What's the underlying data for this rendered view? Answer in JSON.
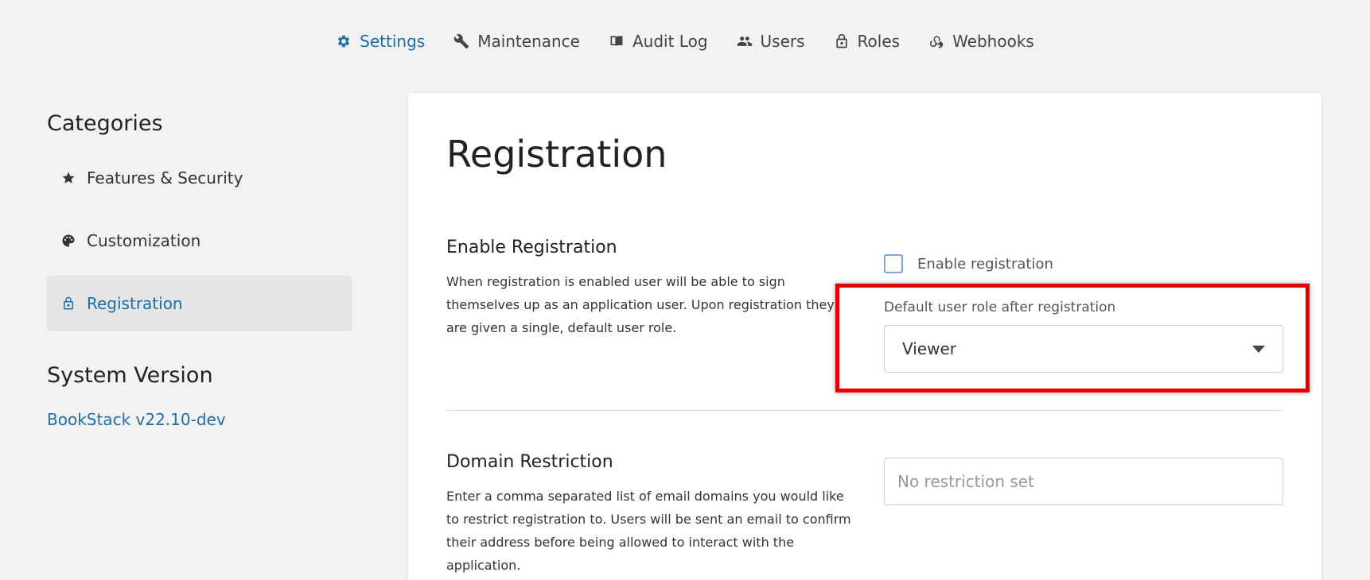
{
  "topnav": {
    "items": [
      {
        "label": "Settings",
        "icon": "gear-icon",
        "active": true
      },
      {
        "label": "Maintenance",
        "icon": "wrench-icon"
      },
      {
        "label": "Audit Log",
        "icon": "book-icon"
      },
      {
        "label": "Users",
        "icon": "users-icon"
      },
      {
        "label": "Roles",
        "icon": "lock-icon"
      },
      {
        "label": "Webhooks",
        "icon": "webhook-icon"
      }
    ]
  },
  "sidebar": {
    "categories_title": "Categories",
    "items": [
      {
        "label": "Features & Security",
        "icon": "star-icon"
      },
      {
        "label": "Customization",
        "icon": "palette-icon"
      },
      {
        "label": "Registration",
        "icon": "lock-icon",
        "active": true
      }
    ],
    "version_title": "System Version",
    "version_link": "BookStack v22.10-dev"
  },
  "main": {
    "title": "Registration",
    "enable_registration": {
      "title": "Enable Registration",
      "description": "When registration is enabled user will be able to sign themselves up as an application user. Upon registration they are given a single, default user role.",
      "checkbox_label": "Enable registration",
      "checked": false,
      "role_label": "Default user role after registration",
      "role_value": "Viewer"
    },
    "domain_restriction": {
      "title": "Domain Restriction",
      "description": "Enter a comma separated list of email domains you would like to restrict registration to. Users will be sent an email to confirm their address before being allowed to interact with the application.",
      "placeholder": "No restriction set"
    }
  },
  "colors": {
    "accent": "#206ea7",
    "highlight": "#e10000"
  }
}
